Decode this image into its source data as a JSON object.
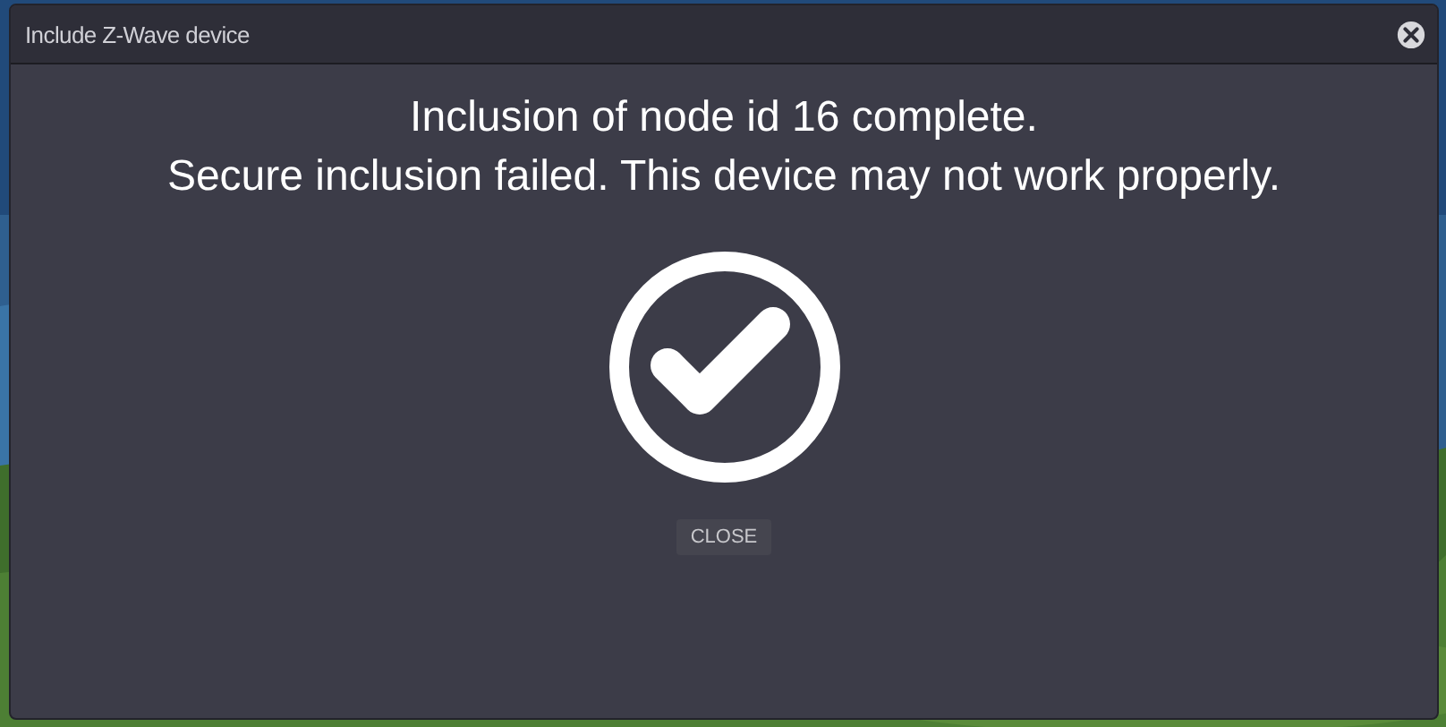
{
  "dialog": {
    "title": "Include Z-Wave device",
    "messages": [
      "Inclusion of node id 16 complete.",
      "Secure inclusion failed. This device may not work properly."
    ],
    "success": true,
    "buttons": [
      "CLOSE"
    ]
  }
}
